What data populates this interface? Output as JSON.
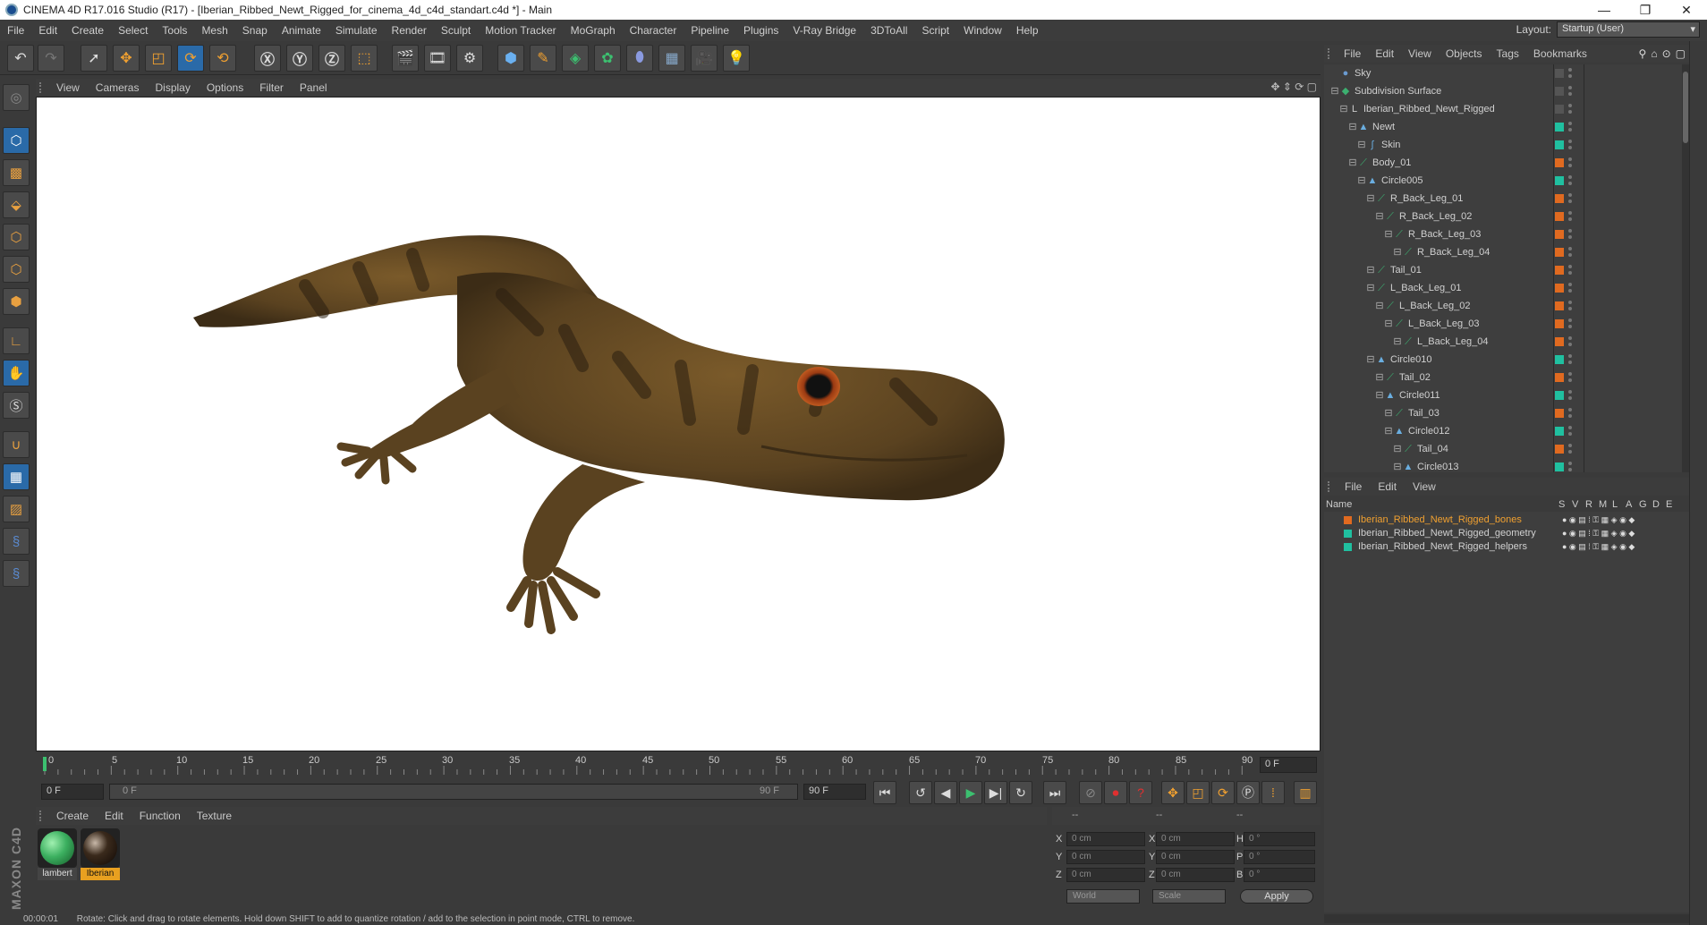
{
  "window": {
    "title": "CINEMA 4D R17.016 Studio (R17) - [Iberian_Ribbed_Newt_Rigged_for_cinema_4d_c4d_standart.c4d *] - Main",
    "minimize": "—",
    "maximize": "❐",
    "close": "✕"
  },
  "menubar": {
    "items": [
      "File",
      "Edit",
      "Create",
      "Select",
      "Tools",
      "Mesh",
      "Snap",
      "Animate",
      "Simulate",
      "Render",
      "Sculpt",
      "Motion Tracker",
      "MoGraph",
      "Character",
      "Pipeline",
      "Plugins",
      "V-Ray Bridge",
      "3DToAll",
      "Script",
      "Window",
      "Help"
    ],
    "layout_label": "Layout:",
    "layout_value": "Startup (User)"
  },
  "viewport": {
    "menu": [
      "View",
      "Cameras",
      "Display",
      "Options",
      "Filter",
      "Panel"
    ],
    "nav_icons": "✥ ⇕ ⟳ ▢"
  },
  "timeline": {
    "ticks": [
      "0",
      "5",
      "10",
      "15",
      "20",
      "25",
      "30",
      "35",
      "40",
      "45",
      "50",
      "55",
      "60",
      "65",
      "70",
      "75",
      "80",
      "85",
      "90"
    ],
    "frame_end": "0 F",
    "current_frame": "0 F",
    "range_start": "0 F",
    "range_end": "90 F",
    "max_frame": "90 F"
  },
  "materials": {
    "menu": [
      "Create",
      "Edit",
      "Function",
      "Texture"
    ],
    "items": [
      {
        "name": "lambert",
        "color": "#3cb060"
      },
      {
        "name": "Iberian",
        "color": "#3a2a1c"
      }
    ]
  },
  "coordinates": {
    "header": [
      "--",
      "--",
      "--"
    ],
    "rows": [
      {
        "a": "X",
        "av": "0 cm",
        "b": "X",
        "bv": "0 cm",
        "c": "H",
        "cv": "0 °"
      },
      {
        "a": "Y",
        "av": "0 cm",
        "b": "Y",
        "bv": "0 cm",
        "c": "P",
        "cv": "0 °"
      },
      {
        "a": "Z",
        "av": "0 cm",
        "b": "Z",
        "bv": "0 cm",
        "c": "B",
        "cv": "0 °"
      }
    ],
    "space": "World",
    "mode": "Scale",
    "apply": "Apply"
  },
  "status": {
    "time": "00:00:01",
    "text": "Rotate: Click and drag to rotate elements. Hold down SHIFT to add to quantize rotation / add to the selection in point mode, CTRL to remove."
  },
  "object_manager": {
    "menu": [
      "File",
      "Edit",
      "View",
      "Objects",
      "Tags",
      "Bookmarks"
    ],
    "objects": [
      {
        "name": "Sky",
        "indent": 0,
        "icon": "●",
        "icolor": "#6a9ad0",
        "tag": "#555"
      },
      {
        "name": "Subdivision Surface",
        "indent": 0,
        "icon": "◆",
        "icolor": "#3cb070",
        "tag": "#555"
      },
      {
        "name": "Iberian_Ribbed_Newt_Rigged",
        "indent": 1,
        "icon": "L",
        "icolor": "#ccc",
        "tag": "#555"
      },
      {
        "name": "Newt",
        "indent": 2,
        "icon": "▲",
        "icolor": "#6aaee0",
        "tag": "#20c0a0"
      },
      {
        "name": "Skin",
        "indent": 3,
        "icon": "∫",
        "icolor": "#6aaee0",
        "tag": "#20c0a0"
      },
      {
        "name": "Body_01",
        "indent": 2,
        "icon": "⟋",
        "icolor": "#3cb070",
        "tag": "#e06a20"
      },
      {
        "name": "Circle005",
        "indent": 3,
        "icon": "▲",
        "icolor": "#6aaee0",
        "tag": "#20c0a0"
      },
      {
        "name": "R_Back_Leg_01",
        "indent": 4,
        "icon": "⟋",
        "icolor": "#3cb070",
        "tag": "#e06a20"
      },
      {
        "name": "R_Back_Leg_02",
        "indent": 5,
        "icon": "⟋",
        "icolor": "#3cb070",
        "tag": "#e06a20"
      },
      {
        "name": "R_Back_Leg_03",
        "indent": 6,
        "icon": "⟋",
        "icolor": "#3cb070",
        "tag": "#e06a20"
      },
      {
        "name": "R_Back_Leg_04",
        "indent": 7,
        "icon": "⟋",
        "icolor": "#3cb070",
        "tag": "#e06a20"
      },
      {
        "name": "Tail_01",
        "indent": 4,
        "icon": "⟋",
        "icolor": "#3cb070",
        "tag": "#e06a20"
      },
      {
        "name": "L_Back_Leg_01",
        "indent": 4,
        "icon": "⟋",
        "icolor": "#3cb070",
        "tag": "#e06a20"
      },
      {
        "name": "L_Back_Leg_02",
        "indent": 5,
        "icon": "⟋",
        "icolor": "#3cb070",
        "tag": "#e06a20"
      },
      {
        "name": "L_Back_Leg_03",
        "indent": 6,
        "icon": "⟋",
        "icolor": "#3cb070",
        "tag": "#e06a20"
      },
      {
        "name": "L_Back_Leg_04",
        "indent": 7,
        "icon": "⟋",
        "icolor": "#3cb070",
        "tag": "#e06a20"
      },
      {
        "name": "Circle010",
        "indent": 4,
        "icon": "▲",
        "icolor": "#6aaee0",
        "tag": "#20c0a0"
      },
      {
        "name": "Tail_02",
        "indent": 5,
        "icon": "⟋",
        "icolor": "#3cb070",
        "tag": "#e06a20"
      },
      {
        "name": "Circle011",
        "indent": 5,
        "icon": "▲",
        "icolor": "#6aaee0",
        "tag": "#20c0a0"
      },
      {
        "name": "Tail_03",
        "indent": 6,
        "icon": "⟋",
        "icolor": "#3cb070",
        "tag": "#e06a20"
      },
      {
        "name": "Circle012",
        "indent": 6,
        "icon": "▲",
        "icolor": "#6aaee0",
        "tag": "#20c0a0"
      },
      {
        "name": "Tail_04",
        "indent": 7,
        "icon": "⟋",
        "icolor": "#3cb070",
        "tag": "#e06a20"
      },
      {
        "name": "Circle013",
        "indent": 7,
        "icon": "▲",
        "icolor": "#6aaee0",
        "tag": "#20c0a0"
      }
    ]
  },
  "layer_manager": {
    "menu": [
      "File",
      "Edit",
      "View"
    ],
    "columns": {
      "name": "Name",
      "flags": [
        "S",
        "V",
        "R",
        "M",
        "L",
        "A",
        "G",
        "D",
        "E"
      ]
    },
    "layers": [
      {
        "name": "Iberian_Ribbed_Newt_Rigged_bones",
        "color": "#e06a20",
        "selected": true
      },
      {
        "name": "Iberian_Ribbed_Newt_Rigged_geometry",
        "color": "#20c0a0",
        "selected": false
      },
      {
        "name": "Iberian_Ribbed_Newt_Rigged_helpers",
        "color": "#20c0a0",
        "selected": false
      }
    ]
  }
}
